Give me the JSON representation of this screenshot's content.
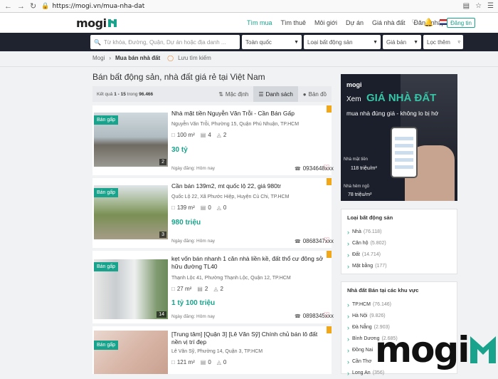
{
  "browser": {
    "url": "https://mogi.vn/mua-nha-dat"
  },
  "nav": {
    "logo": "mogi",
    "links": [
      "Tìm mua",
      "Tìm thuê",
      "Môi giới",
      "Dự án",
      "Giá nhà đất",
      "Đăng nhập"
    ],
    "active_index": 0,
    "post_button": "Đăng tin"
  },
  "search": {
    "keyword_placeholder": "Từ khóa, Đường, Quận, Dự án hoặc địa danh ...",
    "city": "Toàn quốc",
    "type": "Loại bất động sản",
    "price": "Giá bán",
    "filter": "Lọc thêm"
  },
  "breadcrumb": {
    "home": "Mogi",
    "current": "Mua bán nhà đất",
    "save": "Lưu tìm kiếm"
  },
  "page": {
    "title": "Bán bất động sản, nhà đất giá rẻ tại Việt Nam",
    "result_prefix": "Kết quả ",
    "result_range": "1 - 15",
    "result_mid": " trong ",
    "result_total": "96.466",
    "sort": {
      "default": "Mặc định",
      "list": "Danh sách",
      "map": "Bản đồ"
    }
  },
  "listings": [
    {
      "tag": "Bán gấp",
      "photos": "2",
      "title": "Nhà mặt tiền Nguyễn Văn Trỗi - Cần Bán Gấp",
      "address": "Nguyễn Văn Trỗi, Phường 15, Quận Phú Nhuận, TP.HCM",
      "area": "100 m²",
      "beds": "4",
      "baths": "2",
      "price": "30 tỷ",
      "date": "Ngày đăng: Hôm nay",
      "phone": "0934648xxx"
    },
    {
      "tag": "Bán gấp",
      "photos": "3",
      "title": "Cần bán 139m2, mt quốc lộ 22, giá 980tr",
      "address": "Quốc Lộ 22, Xã Phước Hiệp, Huyện Củ Chi, TP.HCM",
      "area": "139 m²",
      "beds": "0",
      "baths": "0",
      "price": "980 triệu",
      "date": "Ngày đăng: Hôm nay",
      "phone": "0868347xxx"
    },
    {
      "tag": "Bán gấp",
      "photos": "14",
      "title": "kẹt vốn bán nhanh 1 căn nhà liền kề, đất thổ cư đông sở hữu đường TL40",
      "address": "Thạnh Lộc 41, Phường Thạnh Lộc, Quận 12, TP.HCM",
      "area": "27 m²",
      "beds": "2",
      "baths": "2",
      "price": "1 tỷ 100 triệu",
      "date": "Ngày đăng: Hôm nay",
      "phone": "0898345xxx"
    },
    {
      "tag": "Bán gấp",
      "photos": "",
      "title": "[Trung tâm] [Quận 3] [Lê Văn Sỹ] Chính chủ bán lô đất nền vị trí đẹp",
      "address": "Lê Văn Sỹ, Phường 14, Quận 3, TP.HCM",
      "area": "121 m²",
      "beds": "0",
      "baths": "0",
      "price": "",
      "date": "",
      "phone": ""
    }
  ],
  "ad": {
    "brand": "mogi",
    "line1": "Xem",
    "headline": "GIÁ NHÀ ĐẤT",
    "line2": "mua nhà đúng giá - không lo bị hớ",
    "p1_label": "Nhà mặt tiền",
    "p1_value": "118 triệu/m²",
    "p2_label": "Nhà hẻm ngõ",
    "p2_value": "78 triệu/m²"
  },
  "types_box": {
    "title": "Loại bất động sản",
    "items": [
      {
        "label": "Nhà",
        "count": "(76.118)"
      },
      {
        "label": "Căn hộ",
        "count": "(5.802)"
      },
      {
        "label": "Đất",
        "count": "(14.714)"
      },
      {
        "label": "Mặt bằng",
        "count": "(177)"
      }
    ]
  },
  "areas_box": {
    "title": "Nhà đất Bán tại các khu vực",
    "items": [
      {
        "label": "TP.HCM",
        "count": "(76.146)"
      },
      {
        "label": "Hà Nội",
        "count": "(9.826)"
      },
      {
        "label": "Đà Nẵng",
        "count": "(2.903)"
      },
      {
        "label": "Bình Dương",
        "count": "(2.685)"
      },
      {
        "label": "Đồng Nai",
        "count": ""
      },
      {
        "label": "Cần Thơ",
        "count": ""
      },
      {
        "label": "Long An",
        "count": "(356)"
      }
    ]
  },
  "watermark": "mogi",
  "colors": {
    "brand": "#1aa38c",
    "dark": "#1f2330",
    "bookmark": "#f0a81a",
    "heart": "#d9455f"
  }
}
